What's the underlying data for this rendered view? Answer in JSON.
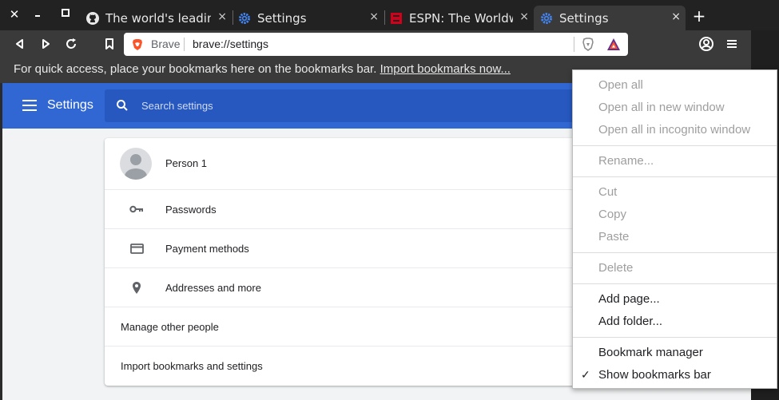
{
  "window_controls": {
    "close": "✕",
    "maximize": "▢"
  },
  "tabs": [
    {
      "title": "The world's leading s",
      "icon": "github-icon",
      "close": "×"
    },
    {
      "title": "Settings",
      "icon": "gear-icon",
      "close": "×"
    },
    {
      "title": "ESPN: The Worldwide",
      "icon": "espn-icon",
      "close": "×"
    },
    {
      "title": "Settings",
      "icon": "gear-icon",
      "close": "×",
      "active": true
    }
  ],
  "new_tab_label": "+",
  "omnibox": {
    "brand": "Brave",
    "url": "brave://settings"
  },
  "bookmarks_bar": {
    "message": "For quick access, place your bookmarks here on the bookmarks bar.",
    "import_link": "Import bookmarks now..."
  },
  "settings": {
    "title": "Settings",
    "search_placeholder": "Search settings",
    "people": {
      "person_name": "Person 1",
      "rows": [
        {
          "label": "Passwords",
          "icon": "key-icon"
        },
        {
          "label": "Payment methods",
          "icon": "credit-card-icon"
        },
        {
          "label": "Addresses and more",
          "icon": "location-pin-icon"
        }
      ],
      "manage_other_people": "Manage other people",
      "import_bookmarks": "Import bookmarks and settings"
    }
  },
  "context_menu": {
    "items": [
      {
        "label": "Open all",
        "enabled": false
      },
      {
        "label": "Open all in new window",
        "enabled": false
      },
      {
        "label": "Open all in incognito window",
        "enabled": false
      },
      {
        "label": "Rename...",
        "enabled": false
      },
      {
        "label": "Cut",
        "enabled": false
      },
      {
        "label": "Copy",
        "enabled": false
      },
      {
        "label": "Paste",
        "enabled": false
      },
      {
        "label": "Delete",
        "enabled": false
      },
      {
        "label": "Add page...",
        "enabled": true
      },
      {
        "label": "Add folder...",
        "enabled": true
      },
      {
        "label": "Bookmark manager",
        "enabled": true
      },
      {
        "label": "Show bookmarks bar",
        "enabled": true,
        "checked": true
      }
    ],
    "check_mark": "✓"
  },
  "colors": {
    "header_blue": "#3167d3",
    "brave_orange": "#fb542b",
    "espn_red": "#d0021b",
    "gear_blue": "#4285f4"
  }
}
